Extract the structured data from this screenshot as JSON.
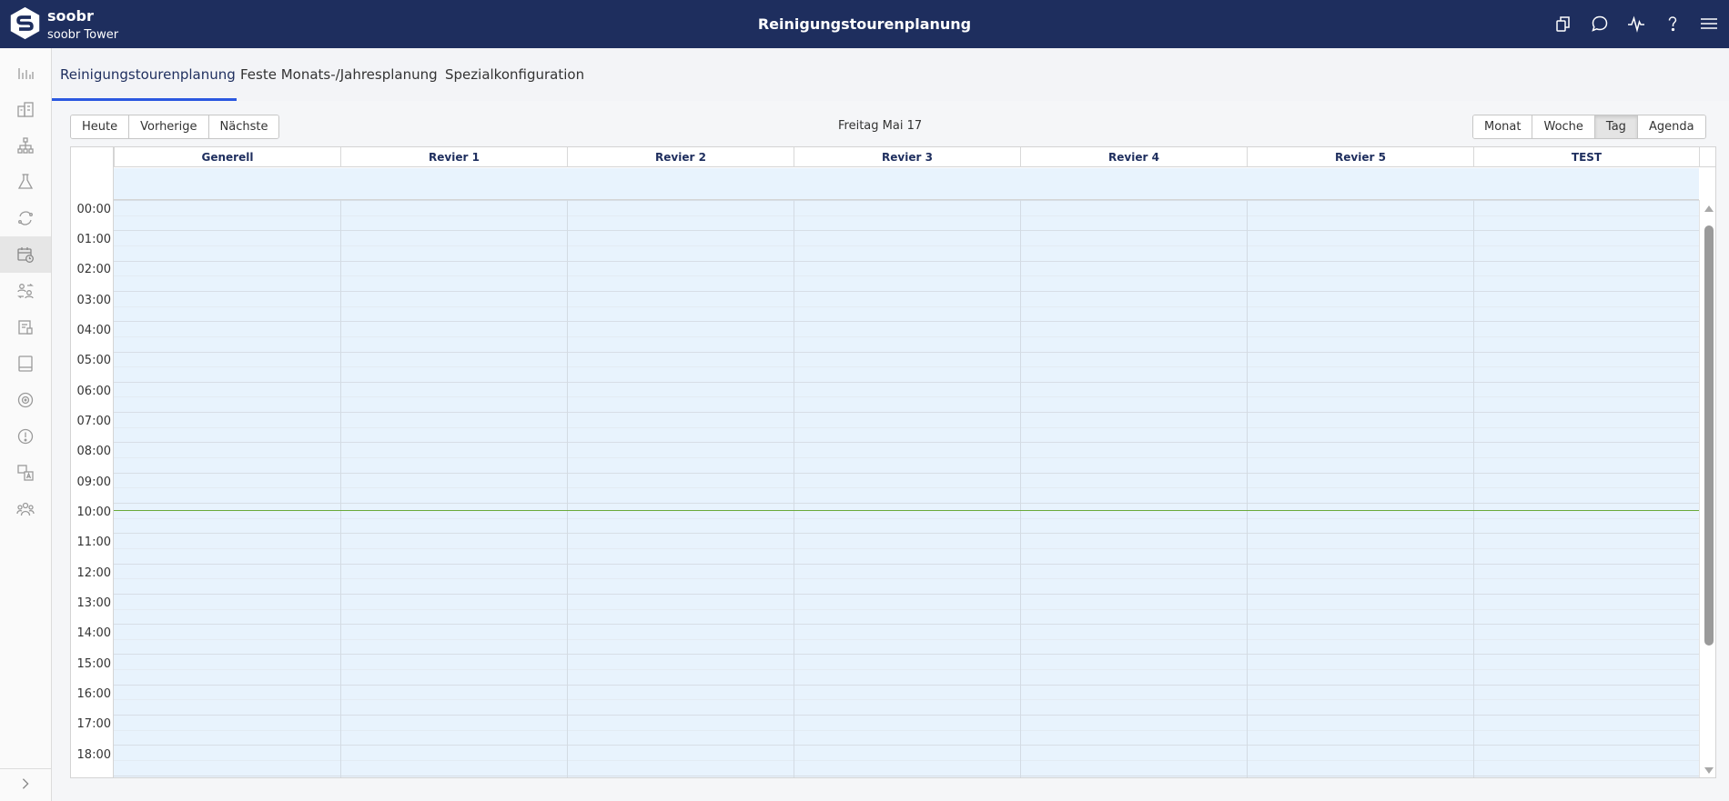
{
  "header": {
    "brand": "soobr",
    "subtitle": "soobr Tower",
    "title": "Reinigungstourenplanung",
    "bg_color": "#1e2e5e",
    "icons": [
      "copy-icon",
      "chat-icon",
      "activity-icon",
      "help-icon",
      "menu-icon"
    ]
  },
  "sidebar": {
    "items": [
      "analytics-icon",
      "buildings-icon",
      "hierarchy-icon",
      "lab-icon",
      "refresh-cycle-icon",
      "calendar-clock-icon",
      "swap-user-icon",
      "document-icon",
      "tablet-icon",
      "sensor-icon",
      "alert-icon",
      "translate-icon",
      "team-icon"
    ],
    "active_item": "calendar-clock-icon",
    "expand_icon": "chevron-right-icon"
  },
  "tabs": [
    {
      "label": "Reinigungstourenplanung",
      "active": true
    },
    {
      "label": "Feste Monats-/Jahresplanung",
      "active": false
    },
    {
      "label": "Spezialkonfiguration",
      "active": false
    }
  ],
  "toolbar": {
    "today": "Heute",
    "prev": "Vorherige",
    "next": "Nächste",
    "date": "Freitag Mai 17",
    "views": [
      "Monat",
      "Woche",
      "Tag",
      "Agenda"
    ],
    "active_view": "Tag"
  },
  "calendar": {
    "columns": [
      "Generell",
      "Revier 1",
      "Revier 2",
      "Revier 3",
      "Revier 4",
      "Revier 5",
      "TEST"
    ],
    "times": [
      "00:00",
      "01:00",
      "02:00",
      "03:00",
      "04:00",
      "05:00",
      "06:00",
      "07:00",
      "08:00",
      "09:00",
      "10:00",
      "11:00",
      "12:00",
      "13:00",
      "14:00",
      "15:00",
      "16:00",
      "17:00",
      "18:00"
    ],
    "slot_bg": "#e8f3fd",
    "now_line_color": "#6aaa3a",
    "accent": "#2b58e0"
  }
}
